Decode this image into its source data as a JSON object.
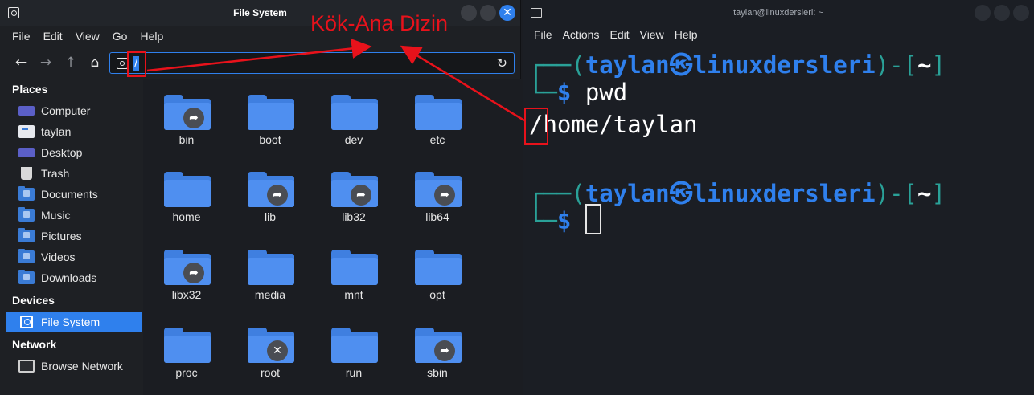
{
  "file_manager": {
    "title": "File System",
    "menu": [
      "File",
      "Edit",
      "View",
      "Go",
      "Help"
    ],
    "address_path": "/",
    "sidebar": {
      "places_header": "Places",
      "places": [
        {
          "label": "Computer",
          "icon": "monitor-icon"
        },
        {
          "label": "taylan",
          "icon": "home-folder-icon"
        },
        {
          "label": "Desktop",
          "icon": "desktop-icon"
        },
        {
          "label": "Trash",
          "icon": "trash-icon"
        },
        {
          "label": "Documents",
          "icon": "documents-folder-icon"
        },
        {
          "label": "Music",
          "icon": "music-folder-icon"
        },
        {
          "label": "Pictures",
          "icon": "pictures-folder-icon"
        },
        {
          "label": "Videos",
          "icon": "videos-folder-icon"
        },
        {
          "label": "Downloads",
          "icon": "downloads-folder-icon"
        }
      ],
      "devices_header": "Devices",
      "devices": [
        {
          "label": "File System",
          "icon": "drive-icon",
          "active": true
        }
      ],
      "network_header": "Network",
      "network": [
        {
          "label": "Browse Network",
          "icon": "network-icon"
        }
      ]
    },
    "folders": [
      {
        "name": "bin",
        "emblem": "symlink"
      },
      {
        "name": "boot",
        "emblem": ""
      },
      {
        "name": "dev",
        "emblem": ""
      },
      {
        "name": "etc",
        "emblem": ""
      },
      {
        "name": "home",
        "emblem": ""
      },
      {
        "name": "lib",
        "emblem": "symlink"
      },
      {
        "name": "lib32",
        "emblem": "symlink"
      },
      {
        "name": "lib64",
        "emblem": "symlink"
      },
      {
        "name": "libx32",
        "emblem": "symlink"
      },
      {
        "name": "media",
        "emblem": ""
      },
      {
        "name": "mnt",
        "emblem": ""
      },
      {
        "name": "opt",
        "emblem": ""
      },
      {
        "name": "proc",
        "emblem": ""
      },
      {
        "name": "root",
        "emblem": "locked"
      },
      {
        "name": "run",
        "emblem": ""
      },
      {
        "name": "sbin",
        "emblem": "symlink"
      }
    ]
  },
  "terminal": {
    "title": "taylan@linuxdersleri: ~",
    "menu": [
      "File",
      "Actions",
      "Edit",
      "View",
      "Help"
    ],
    "prompt_user": "taylan",
    "prompt_symbol": "㉿",
    "prompt_host": "linuxdersleri",
    "prompt_dir": "~",
    "command": "pwd",
    "output": "/home/taylan"
  },
  "annotation": {
    "label": "Kök-Ana Dizin",
    "color": "#e8121b"
  },
  "colors": {
    "accent": "#2f80ed",
    "folder": "#4f8ff0",
    "prompt_line": "#2aa198",
    "annotation": "#e8121b"
  }
}
